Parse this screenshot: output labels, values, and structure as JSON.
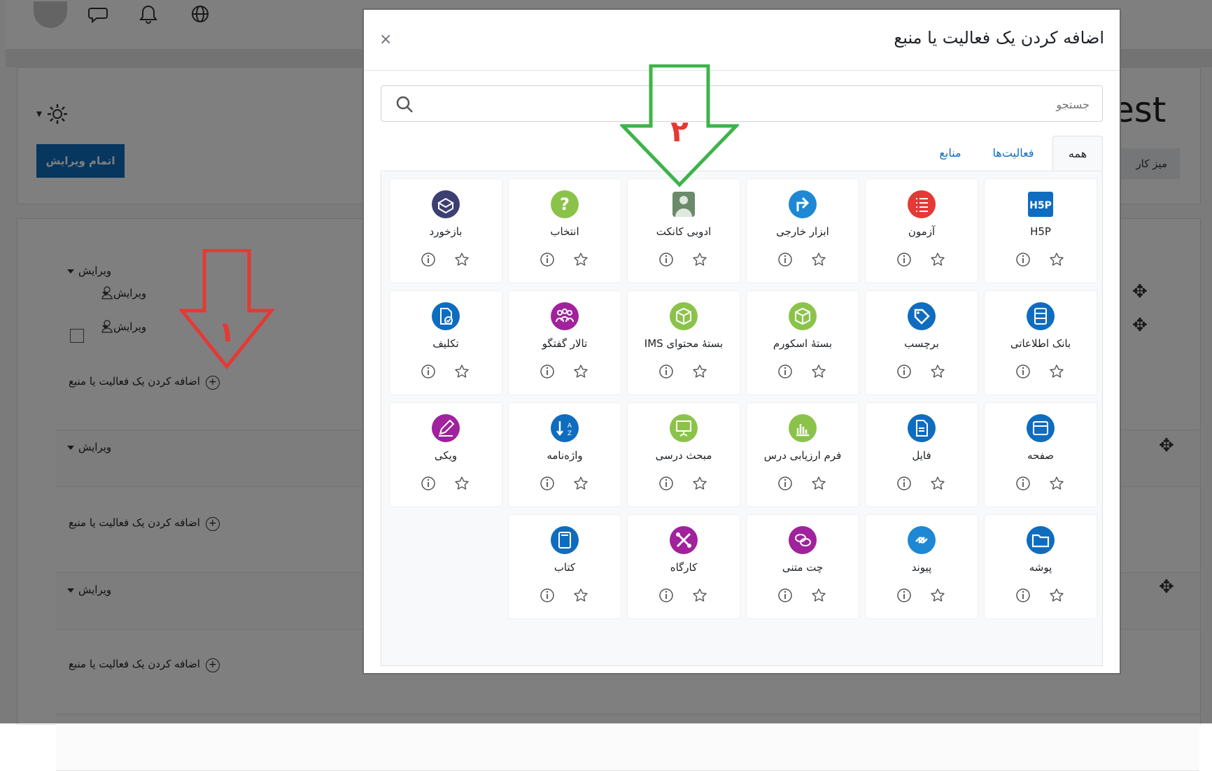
{
  "background": {
    "title_fragment": "est",
    "dashboard_label": "میز کار",
    "finish_edit_button": "اتمام ویرایش",
    "edit_label": "ویرایش",
    "add_activity_label": "اضافه کردن یک فعالیت یا منبع"
  },
  "modal": {
    "title": "اضافه کردن یک فعالیت یا منبع",
    "close": "×",
    "search_placeholder": "جستجو",
    "tabs": [
      {
        "label": "همه",
        "active": true
      },
      {
        "label": "فعالیت‌ها",
        "active": false
      },
      {
        "label": "منابع",
        "active": false
      }
    ],
    "modules": [
      {
        "name": "H5P",
        "icon": "h5p-icon",
        "color": "#0f6cbf"
      },
      {
        "name": "آزمون",
        "icon": "quiz-list-icon",
        "color": "#e53935"
      },
      {
        "name": "ابزار خارجی",
        "icon": "external-tool-icon",
        "color": "#1e88d4"
      },
      {
        "name": "ادوبی کانکت",
        "icon": "adobe-connect-icon",
        "color": "#6a8a6a"
      },
      {
        "name": "انتخاب",
        "icon": "choice-question-icon",
        "color": "#8bc34a"
      },
      {
        "name": "بازخورد",
        "icon": "feedback-icon",
        "color": "#3d3f73"
      },
      {
        "name": "بانک اطلاعاتی",
        "icon": "database-icon",
        "color": "#0f6cbf"
      },
      {
        "name": "برچسب",
        "icon": "label-tag-icon",
        "color": "#0f6cbf"
      },
      {
        "name": "بستهٔ اسکورم",
        "icon": "scorm-package-icon",
        "color": "#8bc34a"
      },
      {
        "name": "بستهٔ محتوای IMS",
        "icon": "ims-package-icon",
        "color": "#8bc34a"
      },
      {
        "name": "تالار گفتگو",
        "icon": "forum-people-icon",
        "color": "#a0229c"
      },
      {
        "name": "تکلیف",
        "icon": "assignment-icon",
        "color": "#0f6cbf"
      },
      {
        "name": "صفحه",
        "icon": "page-icon",
        "color": "#0f6cbf"
      },
      {
        "name": "فایل",
        "icon": "file-icon",
        "color": "#0f6cbf"
      },
      {
        "name": "فرم ارزیابی درس",
        "icon": "survey-chart-icon",
        "color": "#8bc34a"
      },
      {
        "name": "مبحث درسی",
        "icon": "lesson-board-icon",
        "color": "#8bc34a"
      },
      {
        "name": "واژه‌نامه",
        "icon": "glossary-sort-icon",
        "color": "#0f6cbf"
      },
      {
        "name": "ویکی",
        "icon": "wiki-pencil-icon",
        "color": "#a0229c"
      },
      {
        "name": "پوشه",
        "icon": "folder-icon",
        "color": "#0f6cbf"
      },
      {
        "name": "پیوند",
        "icon": "url-link-icon",
        "color": "#1e88d4"
      },
      {
        "name": "چت متنی",
        "icon": "chat-bubbles-icon",
        "color": "#a0229c"
      },
      {
        "name": "کارگاه",
        "icon": "workshop-tools-icon",
        "color": "#a0229c"
      },
      {
        "name": "کتاب",
        "icon": "book-icon",
        "color": "#0f6cbf"
      }
    ]
  },
  "annotations": {
    "arrow1_label": "۱",
    "arrow2_label": "۲",
    "arrow1_color": "#e53935",
    "arrow2_color": "#3db34a"
  }
}
